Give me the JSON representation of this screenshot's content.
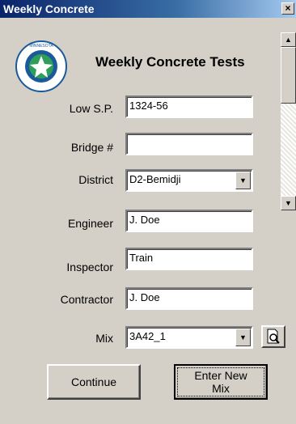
{
  "window": {
    "title": "Weekly Concrete",
    "close_glyph": "✕"
  },
  "header": {
    "title": "Weekly Concrete Tests",
    "logo_icon": "mndot-logo"
  },
  "form": {
    "low_sp": {
      "label": "Low S.P.",
      "value": "1324-56"
    },
    "bridge": {
      "label": "Bridge #",
      "value": ""
    },
    "district": {
      "label": "District",
      "value": "D2-Bemidji"
    },
    "engineer": {
      "label": "Engineer",
      "value": "J. Doe"
    },
    "inspector": {
      "label": "Inspector",
      "value": "Train"
    },
    "contractor": {
      "label": "Contractor",
      "value": "J. Doe"
    },
    "mix": {
      "label": "Mix",
      "value": "3A42_1"
    }
  },
  "buttons": {
    "continue": "Continue",
    "enter_new_mix_line1": "Enter New",
    "enter_new_mix_line2": "Mix"
  },
  "scrollbar": {
    "up": "▲",
    "down": "▼"
  },
  "colors": {
    "titlebar": "#0a246a",
    "face": "#d4d0c8"
  }
}
